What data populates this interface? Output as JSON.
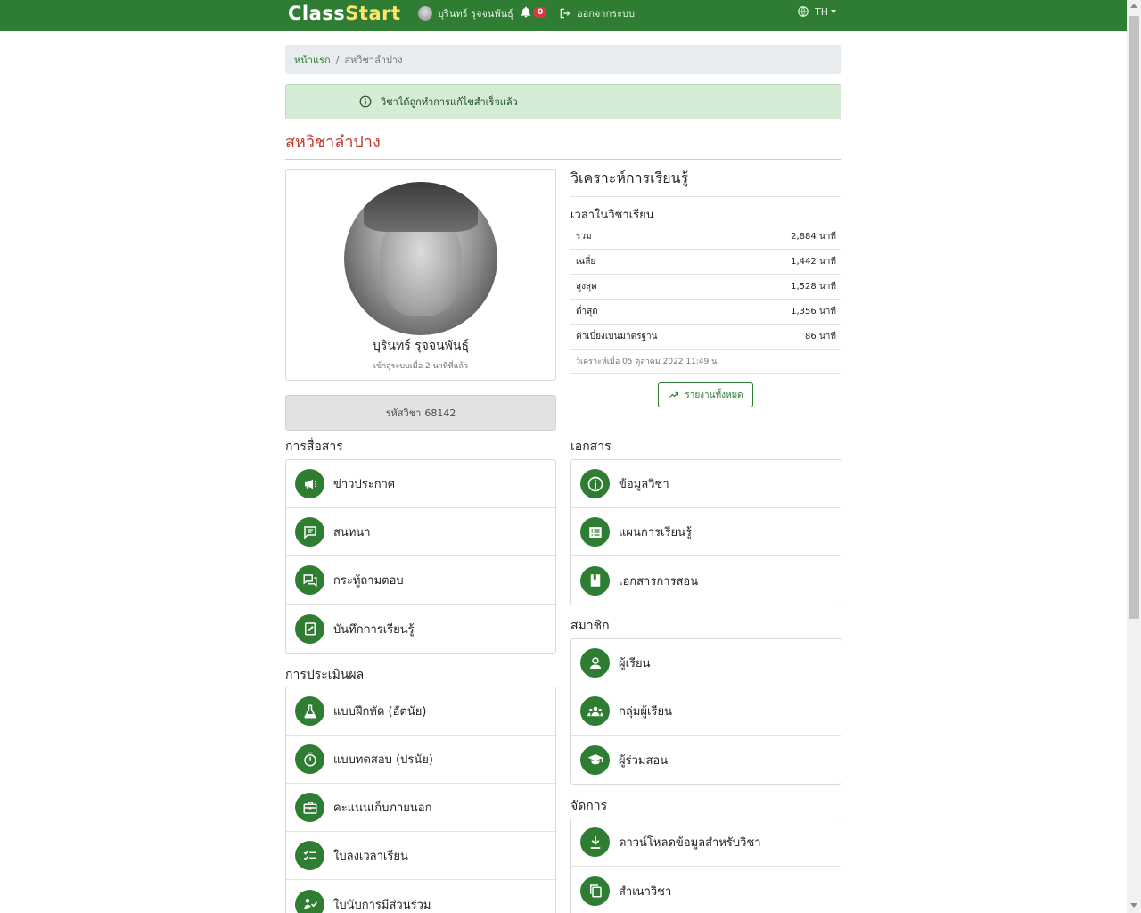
{
  "nav": {
    "brand_part1": "Class",
    "brand_part2": "Start",
    "user_name": "บุรินทร์ รุจจนพันธุ์",
    "notifications_count": "0",
    "logout_label": "ออกจากระบบ",
    "language": "TH"
  },
  "breadcrumb": {
    "home": "หน้าแรก",
    "current": "สหวิชาลำปาง"
  },
  "alert": {
    "message": "วิชาได้ถูกทำการแก้ไขสำเร็จแล้ว"
  },
  "page": {
    "title": "สหวิชาลำปาง"
  },
  "profile": {
    "name": "บุรินทร์ รุจจนพันธุ์",
    "last_login": "เข้าสู่ระบบเมื่อ 2 นาทีที่แล้ว"
  },
  "course_code": {
    "label": "รหัสวิชา",
    "value": "68142"
  },
  "analytics": {
    "title": "วิเคราะห์การเรียนรู้",
    "subtitle": "เวลาในวิชาเรียน",
    "rows": [
      {
        "label": "รวม",
        "value": "2,884 นาที"
      },
      {
        "label": "เฉลี่ย",
        "value": "1,442 นาที"
      },
      {
        "label": "สูงสุด",
        "value": "1,528 นาที"
      },
      {
        "label": "ต่ำสุด",
        "value": "1,356 นาที"
      },
      {
        "label": "ค่าเบี่ยงเบนมาตรฐาน",
        "value": "86 นาที"
      }
    ],
    "analyzed_at": "วิเคราะห์เมื่อ 05 ตุลาคม 2022 11:49 น.",
    "report_button": "รายงานทั้งหมด"
  },
  "sections": {
    "communication": {
      "title": "การสื่อสาร",
      "items": [
        {
          "label": "ข่าวประกาศ",
          "icon": "megaphone-icon"
        },
        {
          "label": "สนทนา",
          "icon": "chat-icon"
        },
        {
          "label": "กระทู้ถามตอบ",
          "icon": "forum-icon"
        },
        {
          "label": "บันทึกการเรียนรู้",
          "icon": "journal-icon"
        }
      ]
    },
    "documents": {
      "title": "เอกสาร",
      "items": [
        {
          "label": "ข้อมูลวิชา",
          "icon": "info-icon"
        },
        {
          "label": "แผนการเรียนรู้",
          "icon": "list-icon"
        },
        {
          "label": "เอกสารการสอน",
          "icon": "book-icon"
        }
      ]
    },
    "assessment": {
      "title": "การประเมินผล",
      "items": [
        {
          "label": "แบบฝึกหัด (อัตนัย)",
          "icon": "flask-icon"
        },
        {
          "label": "แบบทดสอบ (ปรนัย)",
          "icon": "timer-icon"
        },
        {
          "label": "คะแนนเก็บภายนอก",
          "icon": "briefcase-icon"
        },
        {
          "label": "ใบลงเวลาเรียน",
          "icon": "checklist-icon"
        },
        {
          "label": "ใบนับการมีส่วนร่วม",
          "icon": "participation-icon"
        }
      ]
    },
    "members": {
      "title": "สมาชิก",
      "items": [
        {
          "label": "ผู้เรียน",
          "icon": "person-icon"
        },
        {
          "label": "กลุ่มผู้เรียน",
          "icon": "group-icon"
        },
        {
          "label": "ผู้ร่วมสอน",
          "icon": "graduation-cap-icon"
        }
      ]
    },
    "manage": {
      "title": "จัดการ",
      "items": [
        {
          "label": "ดาวน์โหลดข้อมูลสำหรับวิชา",
          "icon": "download-icon"
        },
        {
          "label": "สำเนาวิชา",
          "icon": "copy-icon"
        }
      ]
    }
  },
  "colors": {
    "brand_green": "#2e7d32",
    "brand_yellow": "#ffe36a",
    "title_red": "#c0392b",
    "alert_bg": "#d4ecd6"
  }
}
